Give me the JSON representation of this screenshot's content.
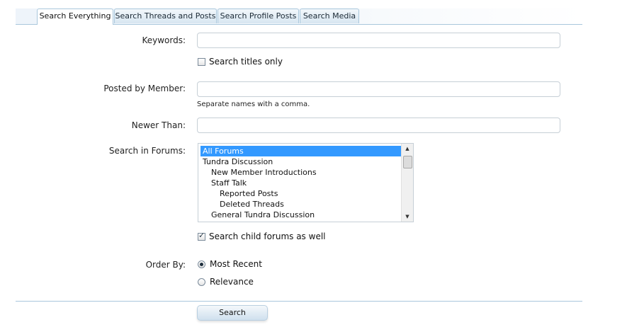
{
  "tabs": [
    {
      "label": "Search Everything",
      "active": true
    },
    {
      "label": "Search Threads and Posts",
      "active": false
    },
    {
      "label": "Search Profile Posts",
      "active": false
    },
    {
      "label": "Search Media",
      "active": false
    }
  ],
  "form": {
    "keywords_label": "Keywords:",
    "keywords_value": "",
    "titles_only_label": "Search titles only",
    "titles_only_checked": false,
    "posted_by_label": "Posted by Member:",
    "posted_by_value": "",
    "posted_by_hint": "Separate names with a comma.",
    "newer_than_label": "Newer Than:",
    "newer_than_value": "",
    "forums_label": "Search in Forums:",
    "forums": [
      {
        "label": "All Forums",
        "level": 0,
        "selected": true
      },
      {
        "label": "Tundra Discussion",
        "level": 0,
        "selected": false
      },
      {
        "label": "New Member Introductions",
        "level": 1,
        "selected": false
      },
      {
        "label": "Staff Talk",
        "level": 1,
        "selected": false
      },
      {
        "label": "Reported Posts",
        "level": 2,
        "selected": false
      },
      {
        "label": "Deleted Threads",
        "level": 2,
        "selected": false
      },
      {
        "label": "General Tundra Discussion",
        "level": 1,
        "selected": false
      }
    ],
    "child_forums_label": "Search child forums as well",
    "child_forums_checked": true,
    "order_by_label": "Order By:",
    "order_options": [
      {
        "label": "Most Recent",
        "checked": true
      },
      {
        "label": "Relevance",
        "checked": false
      }
    ],
    "search_button": "Search"
  }
}
